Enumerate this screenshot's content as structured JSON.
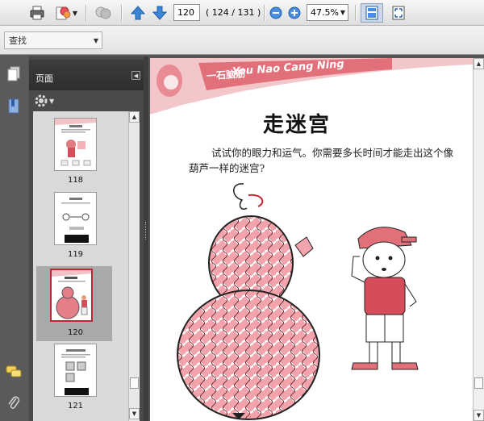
{
  "toolbar": {
    "page_number": "120",
    "page_count": "( 124 / 131 )",
    "zoom": "47.5%"
  },
  "find": {
    "placeholder": "查找"
  },
  "panel": {
    "title": "页面",
    "thumbnails": [
      {
        "label": "118",
        "selected": false
      },
      {
        "label": "119",
        "selected": false
      },
      {
        "label": "120",
        "selected": true
      },
      {
        "label": "121",
        "selected": false
      }
    ]
  },
  "document": {
    "header_label": "一石脑筋",
    "header_latin": "You Nao Cang Ning",
    "title": "走迷宫",
    "text": "试试你的眼力和运气。你需要多长时间才能走出这个像葫芦一样的迷宫?"
  },
  "colors": {
    "accent_red": "#e2707a",
    "selected_thumb_bg": "#a9a9a9",
    "panel_dark": "#4a4a4a"
  }
}
